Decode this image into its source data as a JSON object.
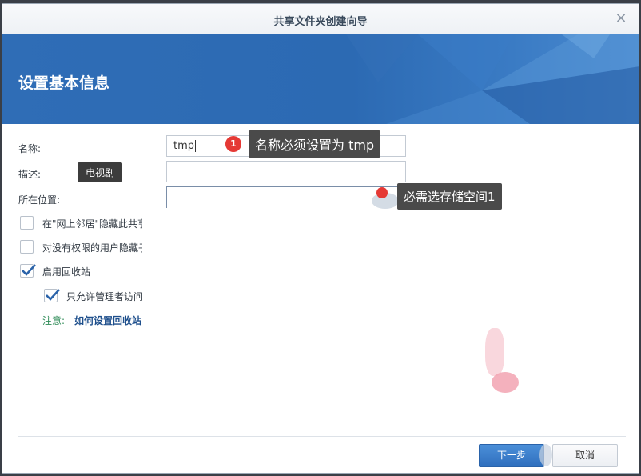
{
  "window": {
    "title": "共享文件夹创建向导",
    "close_glyph": "×"
  },
  "banner": {
    "title": "设置基本信息",
    "color": "#2f6db6"
  },
  "form": {
    "name_label": "名称:",
    "name_value": "tmp",
    "description_label": "描述:",
    "description_value": "",
    "location_label": "所在位置:",
    "location_value": ""
  },
  "options": {
    "hide_network": {
      "label": "在\"网上邻居\"隐藏此共享",
      "checked": false
    },
    "hide_subfolders": {
      "label": "对没有权限的用户隐藏子文件夹和文件",
      "checked": false
    },
    "enable_recycle": {
      "label": "启用回收站",
      "checked": true
    },
    "admin_only": {
      "label": "只允许管理者访问",
      "checked": true
    }
  },
  "note": {
    "prefix": "注意:",
    "link": "如何设置回收站"
  },
  "annotations": {
    "tooltip": "电视剧",
    "callout_name": "名称必须设置为  tmp",
    "callout_location": "必需选存储空间1",
    "badge_number": "1",
    "badge_color": "#e53935"
  },
  "buttons": {
    "next": "下一步",
    "cancel": "取消"
  }
}
